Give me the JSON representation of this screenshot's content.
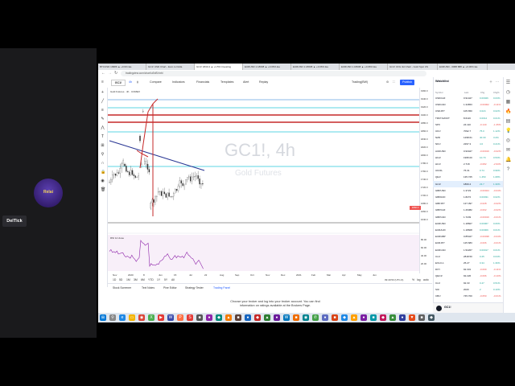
{
  "webcam": {
    "logo_text": "Relai",
    "name_tag": "DelTick"
  },
  "browser": {
    "tabs": [
      "BTCUSD 19986 ▲ +0.9% Ea",
      "GC1! USD Chart - Euro to Dolla",
      "GC1! 1840.4 ▲ +1.5% Investing",
      "EURUSD 1.18608 ▲ +0.06% Ea",
      "EURUSD 1.18608 ▲ +0.06% Ea",
      "EURUSD 1.18608 ▲ +0.06% Ea",
      "GC1! CFG 4H Chart - Gold Spot US",
      "EURUSD - 0988 888 ▲ +0.06% Ea"
    ],
    "url": "tradingview.com/chart/uSnBVvrb/"
  },
  "tv_header": {
    "symbol": "GC1!",
    "buttons": [
      "Compare",
      "Indicators",
      "Financials",
      "Templates",
      "Alert",
      "Replay"
    ],
    "layout_name": "Trading(BW)",
    "publish": "Publish"
  },
  "chart": {
    "watermark": "GC1!, 4h",
    "watermark_sub": "Gold Futures",
    "legend": "Gold Futures  ·  4h  ·  COMEX",
    "indicator_label": "RSI 14 close",
    "last_price_label": "1860.0",
    "price_ticks": [
      "1960.0",
      "1940.0",
      "1920.0",
      "1900.0",
      "1880.0",
      "1860.0",
      "1840.0",
      "1820.0",
      "1800.0",
      "1780.0",
      "1760.0",
      "1740.0",
      "1720.0",
      "1700.0",
      "1680.0",
      "1660.0",
      "1640.0"
    ],
    "rsi_ticks": [
      "80.00",
      "60.00",
      "40.00",
      "20.00"
    ],
    "time_ticks": [
      "Nov",
      "2020",
      "8",
      "Jun",
      "15",
      "Jul",
      "22",
      "Aug",
      "Sep",
      "Oct",
      "Nov",
      "Dec",
      "2021",
      "Feb",
      "Mar",
      "Apr",
      "May",
      "Jun"
    ],
    "time_right": "09:40:53 (UTC-6)",
    "periods": [
      "1D",
      "5D",
      "1M",
      "3M",
      "6M",
      "YTD",
      "1Y",
      "5Y",
      "All"
    ],
    "period_right": [
      "%",
      "log",
      "auto"
    ]
  },
  "bottom_tabs": [
    "Stock Screener",
    "Text Notes",
    "Pine Editor",
    "Strategy Tester",
    "Trading Panel"
  ],
  "broker_message": {
    "line1": "Choose your broker and log into your broker account. You can find",
    "line2": "information on ratings available at the Brokers Page."
  },
  "watchlist": {
    "title": "Watchlist",
    "columns": [
      "Symbol",
      "Last",
      "Chg",
      "Chg%"
    ],
    "rows": [
      {
        "sym": "USDCHF",
        "last": "0.91427",
        "chg": "0.00026",
        "pct": "0.03%",
        "up": true
      },
      {
        "sym": "USDCAD",
        "last": "1.34653",
        "chg": "-0.00002",
        "pct": "-0.11%",
        "up": false
      },
      {
        "sym": "USDJPY",
        "last": "105.650",
        "chg": "0.024",
        "pct": "0.02%",
        "up": true
      },
      {
        "sym": "TRKT/A/DOT",
        "last": "8.6116",
        "chg": "0.0012",
        "pct": "0.01%",
        "up": true
      },
      {
        "sym": "SPX",
        "last": "24.110",
        "chg": "-0.140",
        "pct": "-1.35%",
        "up": false
      },
      {
        "sym": "UK1!",
        "last": "7092.7",
        "chg": "75.0",
        "pct": "1.12%",
        "up": true
      },
      {
        "sym": "NZD",
        "last": "1298.61",
        "chg": "40.30",
        "pct": "3.2%",
        "up": true
      },
      {
        "sym": "NK1!",
        "last": "2297.3",
        "chg": "4.0",
        "pct": "0.21%",
        "up": true
      },
      {
        "sym": "AUDUSD",
        "last": "0.93427",
        "chg": "-0.00019",
        "pct": "-0.02%",
        "up": false
      },
      {
        "sym": "HG1!",
        "last": "1995.00",
        "chg": "10.70",
        "pct": "0.53%",
        "up": true
      },
      {
        "sym": "HU1!",
        "last": "2.718",
        "chg": "-0.082",
        "pct": "-2.93%",
        "up": false
      },
      {
        "sym": "UKOIL",
        "last": "76.31",
        "chg": "0.74",
        "pct": "0.99%",
        "up": true
      },
      {
        "sym": "QE1!",
        "last": "135.725",
        "chg": "1.450",
        "pct": "1.08%",
        "up": true
      },
      {
        "sym": "GC1!",
        "last": "1860.4",
        "chg": "23.7",
        "pct": "1.30%",
        "up": true,
        "selected": true
      },
      {
        "sym": "GBPUSD",
        "last": "1.3723",
        "chg": "-0.00024",
        "pct": "-0.04%",
        "up": false
      },
      {
        "sym": "GBPAUD",
        "last": "1.8272",
        "chg": "0.00031",
        "pct": "0.02%",
        "up": true
      },
      {
        "sym": "GBPJPY",
        "last": "137.397",
        "chg": "-0.028",
        "pct": "-0.02%",
        "up": false
      },
      {
        "sym": "GBPCHF",
        "last": "1.26382",
        "chg": "-0.002",
        "pct": "-0.02%",
        "up": false
      },
      {
        "sym": "GBPCAD",
        "last": "1.7249",
        "chg": "-0.00019",
        "pct": "-0.01%",
        "up": false
      },
      {
        "sym": "EURUSD",
        "last": "1.18607",
        "chg": "0.00067",
        "pct": "0.06%",
        "up": true
      },
      {
        "sym": "EURAUD",
        "last": "1.18608",
        "chg": "0.00009",
        "pct": "0.01%",
        "up": true
      },
      {
        "sym": "EURGBP",
        "last": "0.85427",
        "chg": "-0.00038",
        "pct": "-0.04%",
        "up": false
      },
      {
        "sym": "EURJPY",
        "last": "125.683",
        "chg": "-0.006",
        "pct": "-0.01%",
        "up": false
      },
      {
        "sym": "EURCAD",
        "last": "1.52267",
        "chg": "0.00017",
        "pct": "0.01%",
        "up": true
      },
      {
        "sym": "CL1!",
        "last": "2818.50",
        "chg": "0.25",
        "pct": "0.04%",
        "up": true
      },
      {
        "sym": "EXLO-1",
        "last": "25.27",
        "chg": "0.34",
        "pct": "1.36%",
        "up": true
      },
      {
        "sym": "DXY",
        "last": "92.331",
        "chg": "-0.099",
        "pct": "-0.11%",
        "up": false
      },
      {
        "sym": "QEC1!",
        "last": "92.226",
        "chg": "-0.096",
        "pct": "-0.10%",
        "up": false
      },
      {
        "sym": "CL1!",
        "last": "92.33",
        "chg": "0.47",
        "pct": "0.51%",
        "up": true
      },
      {
        "sym": "SI1!",
        "last": "2020",
        "chg": "2",
        "pct": "0.10%",
        "up": true
      },
      {
        "sym": "CB1!",
        "last": "745.700",
        "chg": "-0.050",
        "pct": "-0.01%",
        "up": false
      }
    ],
    "footer_symbol": "GC1!"
  }
}
